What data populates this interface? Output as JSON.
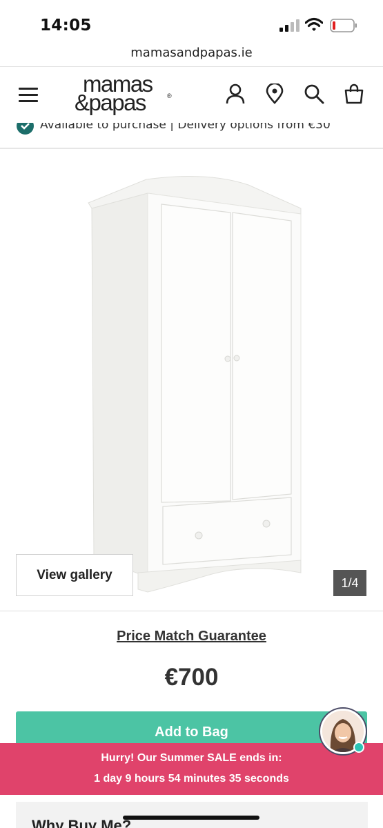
{
  "status_bar": {
    "time": "14:05",
    "icons": [
      "cellular-signal-icon",
      "wifi-icon",
      "battery-icon"
    ]
  },
  "browser": {
    "url": "mamasandpapas.ie"
  },
  "header": {
    "logo_line1": "mamas",
    "logo_line2": "&papas",
    "logo_reg": "®",
    "icons": [
      "menu-icon",
      "account-icon",
      "store-locator-icon",
      "search-icon",
      "bag-icon"
    ]
  },
  "availability": {
    "text": "Available to purchase  |  Delivery options from €30"
  },
  "gallery": {
    "view_gallery_label": "View gallery",
    "counter": "1/4"
  },
  "product": {
    "price_match_label": "Price Match Guarantee",
    "price": "€700",
    "add_to_bag_label": "Add to Bag"
  },
  "sale_banner": {
    "line1": "Hurry! Our Summer SALE ends in:",
    "line2": "1 day 9 hours 54 minutes 35 seconds"
  },
  "why_buy": {
    "heading": "Why Buy Me?"
  },
  "colors": {
    "add_to_bag": "#4cc4a4",
    "sale_banner": "#e0436b",
    "check_badge": "#1c6e6a",
    "chat_online": "#2bc4b4"
  }
}
